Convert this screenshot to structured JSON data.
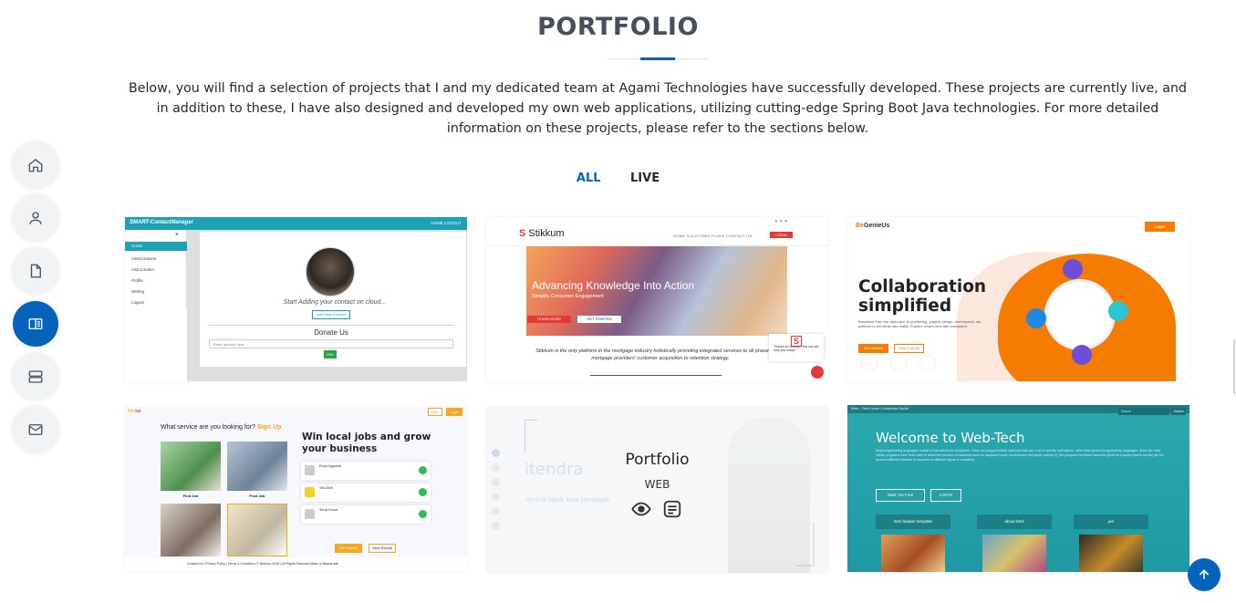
{
  "section": {
    "title": "PORTFOLIO",
    "intro": "Below, you will find a selection of projects that I and my dedicated team at Agami Technologies have successfully developed. These projects are currently live, and in addition to these, I have also designed and developed my own web applications, utilizing cutting-edge Spring Boot Java technologies. For more detailed information on these projects, please refer to the sections below."
  },
  "filters": [
    {
      "label": "ALL",
      "active": true
    },
    {
      "label": "LIVE",
      "active": false
    }
  ],
  "side_nav": {
    "items": [
      {
        "icon": "home-icon",
        "active": false
      },
      {
        "icon": "person-icon",
        "active": false
      },
      {
        "icon": "file-icon",
        "active": false
      },
      {
        "icon": "portfolio-icon",
        "active": true
      },
      {
        "icon": "server-icon",
        "active": false
      },
      {
        "icon": "envelope-icon",
        "active": false
      }
    ],
    "active_color": "#0563bb",
    "inactive_color": "#f2f3f5"
  },
  "cards": {
    "c1": {
      "brand": "SMART-ContactManager",
      "top_links": "HOME   LOGOUT",
      "close": "×",
      "menu": [
        "Home",
        "ViewContacts",
        "Add Contact",
        "Profile",
        "Setting",
        "Logout"
      ],
      "start_msg": "Start Adding your contact on cloud...",
      "add_btn": "Add New Contact",
      "donate": "Donate Us",
      "amount_placeholder": "Enter Amount here...",
      "pay": "PAY"
    },
    "c2": {
      "logo_mark": "S",
      "logo_text": "Stikkum",
      "menu": "HOME   SOLUTIONS   PLANS   CONTACT US",
      "login": "LOGIN",
      "hero": "Advancing Knowledge Into Action",
      "hero_sub": "Simplify Consumer Engagement",
      "btn1": "LEARN MORE",
      "btn2": "GET STARTED",
      "desc": "Stikkum is the only platform in the mortgage industry holistically providing integrated services to all phases of the mortgage providers' customer acquisition to retention strategy.",
      "chat": "Thanks for visiting! How can we help you today?"
    },
    "c3": {
      "logo_prefix": "Be",
      "logo_text": "GenieUs",
      "login": "Login",
      "title_line1": "Collaboration",
      "title_line2": "simplified",
      "sub": "Breakfree from the clipboard. In publishing, graphic design, and beyond, our platform is the ideas into reality. Explore what's new with innovation.",
      "btn1": "Get Started",
      "btn2": "How it works"
    },
    "c4": {
      "logo_prefix": "Ned",
      "logo_text": "uz",
      "hire": "Hire",
      "login": "Login",
      "question": "What service are you looking for?",
      "question_cta": "Sign Up",
      "captions": [
        "Find Job",
        "Post Job"
      ],
      "headline_line1": "Win local jobs and grow",
      "headline_line2": "your business",
      "rows": [
        "Divya Aggarwal",
        "Vika Dixit",
        "Shruti Kumar"
      ],
      "btn1": "Get Started",
      "btn2": "View Events",
      "footer": "Contact Us  |  Privacy Policy  |  Terms & Conditions    © NedUaz 2025 | All Rights Reserved         Made in Bharat with"
    },
    "c5": {
      "watermark_name": "itendra",
      "watermark_sub": "I'm Full Stack Java Developer",
      "title": "Portfolio",
      "category": "WEB",
      "view_icon": "eye-icon",
      "details_icon": "details-icon"
    },
    "c6": {
      "topbar": "Web - Tech    Learn  Contribute  Doubt",
      "search": "Search",
      "search_btn": "Search",
      "welcome": "Welcome to Web-Tech",
      "para": "Most programming languages consist of instructions for computers. There are programmable machines that use a set of specific instructions, rather than general programming languages. Since the early 1800s, programs have been used to direct the behavior of machines such as Jacquard looms, music boxes and player pianos.[1] The programs for these machines (such as a player piano's scrolls) did not produce different behavior in response to different inputs or conditions.",
      "start": "Start ! Its Free",
      "login": "LOGIN",
      "tiles": [
        "html header template",
        "about html",
        "jee"
      ]
    }
  },
  "colors": {
    "accent": "#0563bb",
    "heading": "#45505b"
  }
}
